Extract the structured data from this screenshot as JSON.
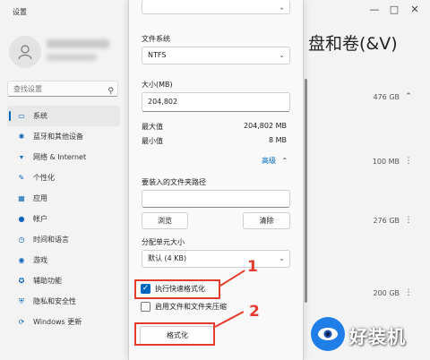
{
  "window": {
    "title": "设置"
  },
  "sidebar": {
    "search_placeholder": "查找设置",
    "items": [
      {
        "label": "系统",
        "icon": "monitor-icon"
      },
      {
        "label": "蓝牙和其他设备",
        "icon": "bluetooth-icon"
      },
      {
        "label": "网络 & Internet",
        "icon": "wifi-icon"
      },
      {
        "label": "个性化",
        "icon": "brush-icon"
      },
      {
        "label": "应用",
        "icon": "apps-icon"
      },
      {
        "label": "帐户",
        "icon": "person-icon"
      },
      {
        "label": "时间和语言",
        "icon": "globe-icon"
      },
      {
        "label": "游戏",
        "icon": "gamepad-icon"
      },
      {
        "label": "辅助功能",
        "icon": "accessibility-icon"
      },
      {
        "label": "隐私和安全性",
        "icon": "shield-icon"
      },
      {
        "label": "Windows 更新",
        "icon": "update-icon"
      }
    ]
  },
  "main": {
    "title_fragment": "盘和卷(&V)",
    "disk_sizes": [
      "476 GB",
      "100 MB",
      "276 GB",
      "200 GB"
    ]
  },
  "dialog": {
    "filesystem_label": "文件系统",
    "filesystem_value": "NTFS",
    "size_label": "大小(MB)",
    "size_value": "204,802",
    "max_label": "最大值",
    "max_value": "204,802 MB",
    "min_label": "最小值",
    "min_value": "8 MB",
    "advanced_label": "高级",
    "mount_path_label": "要装入的文件夹路径",
    "mount_path_value": "",
    "browse_label": "浏览",
    "clear_label": "清除",
    "alloc_unit_label": "分配单元大小",
    "alloc_unit_value": "默认 (4 KB)",
    "quick_format_label": "执行快速格式化",
    "quick_format_checked": true,
    "compression_label": "启用文件和文件夹压缩",
    "compression_checked": false,
    "format_button_label": "格式化"
  },
  "annotations": {
    "step1": "1",
    "step2": "2"
  },
  "watermark": {
    "text": "好装机"
  },
  "colors": {
    "accent": "#0067c0",
    "annotation": "#e53b2c",
    "watermark": "#1f7ee8"
  }
}
